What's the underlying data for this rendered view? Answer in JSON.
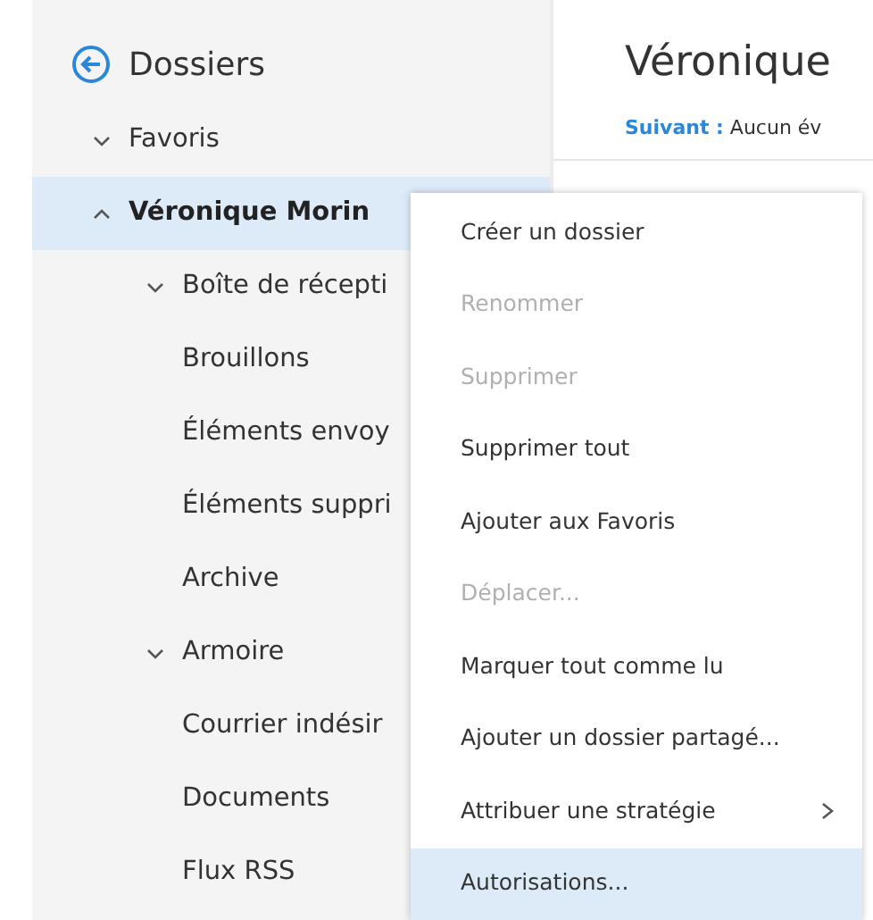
{
  "sidebar": {
    "title": "Dossiers",
    "items": [
      {
        "label": "Favoris",
        "expanded": false,
        "selected": false
      },
      {
        "label": "Véronique Morin",
        "expanded": true,
        "selected": true,
        "children": [
          {
            "label": "Boîte de récepti",
            "expanded": false,
            "selected": false
          },
          {
            "label": "Brouillons",
            "selected": false
          },
          {
            "label": "Éléments envoy",
            "selected": false
          },
          {
            "label": "Éléments suppri",
            "selected": false
          },
          {
            "label": "Archive",
            "selected": false
          },
          {
            "label": "Armoire",
            "expanded": false,
            "selected": false
          },
          {
            "label": "Courrier indésir",
            "selected": false
          },
          {
            "label": "Documents",
            "selected": false
          },
          {
            "label": "Flux RSS",
            "selected": false
          }
        ]
      }
    ]
  },
  "main": {
    "title": "Véronique",
    "next_label": "Suivant :",
    "next_text": "Aucun év"
  },
  "context_menu": [
    {
      "label": "Créer un dossier",
      "disabled": false,
      "selected": false
    },
    {
      "label": "Renommer",
      "disabled": true,
      "selected": false
    },
    {
      "label": "Supprimer",
      "disabled": true,
      "selected": false
    },
    {
      "label": "Supprimer tout",
      "disabled": false,
      "selected": false
    },
    {
      "label": "Ajouter aux Favoris",
      "disabled": false,
      "selected": false
    },
    {
      "label": "Déplacer...",
      "disabled": true,
      "selected": false
    },
    {
      "label": "Marquer tout comme lu",
      "disabled": false,
      "selected": false
    },
    {
      "label": "Ajouter un dossier partagé...",
      "disabled": false,
      "selected": false
    },
    {
      "label": "Attribuer une stratégie",
      "disabled": false,
      "selected": false,
      "submenu": true
    },
    {
      "label": "Autorisations...",
      "disabled": false,
      "selected": true
    }
  ]
}
